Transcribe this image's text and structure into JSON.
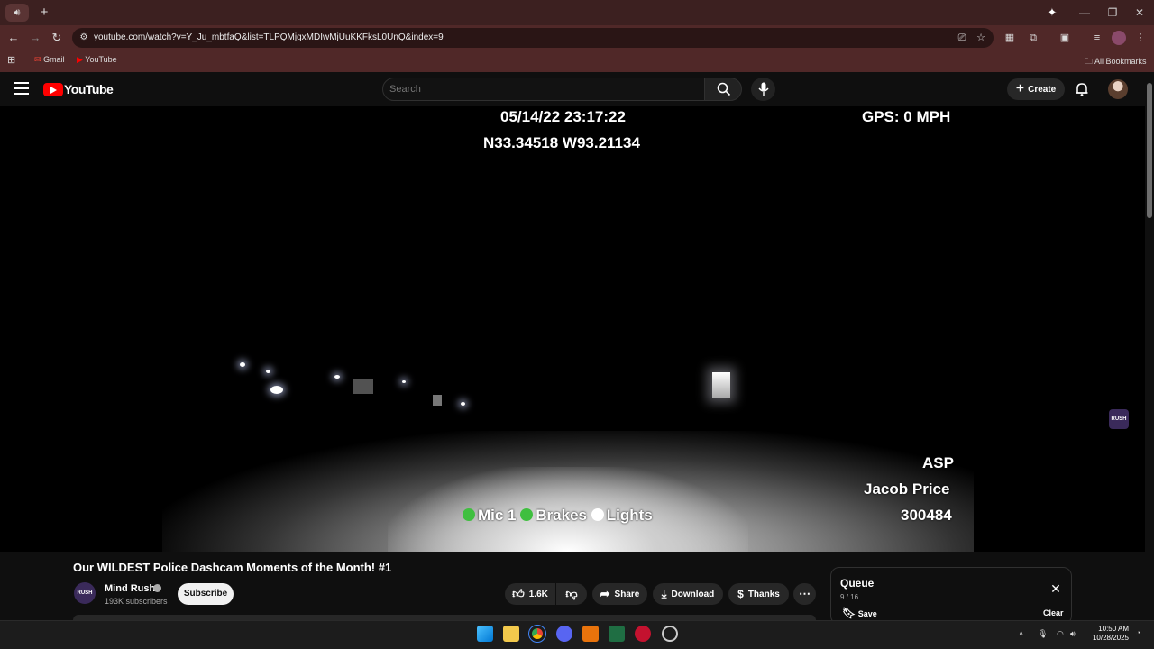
{
  "browser": {
    "url": "youtube.com/watch?v=Y_Ju_mbtfaQ&list=TLPQMjgxMDIwMjUuKKFksL0UnQ&index=9",
    "bookmarks": [
      {
        "label": "Gmail"
      },
      {
        "label": "YouTube"
      }
    ],
    "all_bookmarks_label": "All Bookmarks"
  },
  "youtube": {
    "logo_text": "YouTube",
    "search_placeholder": "Search",
    "create_label": "Create"
  },
  "video": {
    "overlay_datetime": "05/14/22 23:17:22",
    "overlay_coords": "N33.34518 W93.21134",
    "overlay_gps": "GPS: 0 MPH",
    "overlay_agency": "ASP",
    "overlay_officer": "Jacob Price",
    "overlay_id": "300484",
    "indicators": [
      {
        "label": "Mic 1",
        "color": "#3fbf3f"
      },
      {
        "label": "Brakes",
        "color": "#3fbf3f"
      },
      {
        "label": "Lights",
        "color": "#ffffff"
      }
    ],
    "watermark": "RUSH"
  },
  "details": {
    "title": "Our WILDEST Police Dashcam Moments of the Month! #1",
    "channel_name": "Mind Rush",
    "channel_avatar_text": "RUSH",
    "subscribers": "193K subscribers",
    "subscribe_label": "Subscribe",
    "likes": "1.6K",
    "share_label": "Share",
    "download_label": "Download",
    "thanks_label": "Thanks"
  },
  "queue": {
    "title": "Queue",
    "count": "9 / 16",
    "save_label": "Save",
    "clear_label": "Clear"
  },
  "taskbar": {
    "time": "10:50 AM",
    "date": "10/28/2025"
  },
  "colors": {
    "browser_frame": "#502828",
    "youtube_red": "#ff0000",
    "background": "#0f0f0f"
  }
}
